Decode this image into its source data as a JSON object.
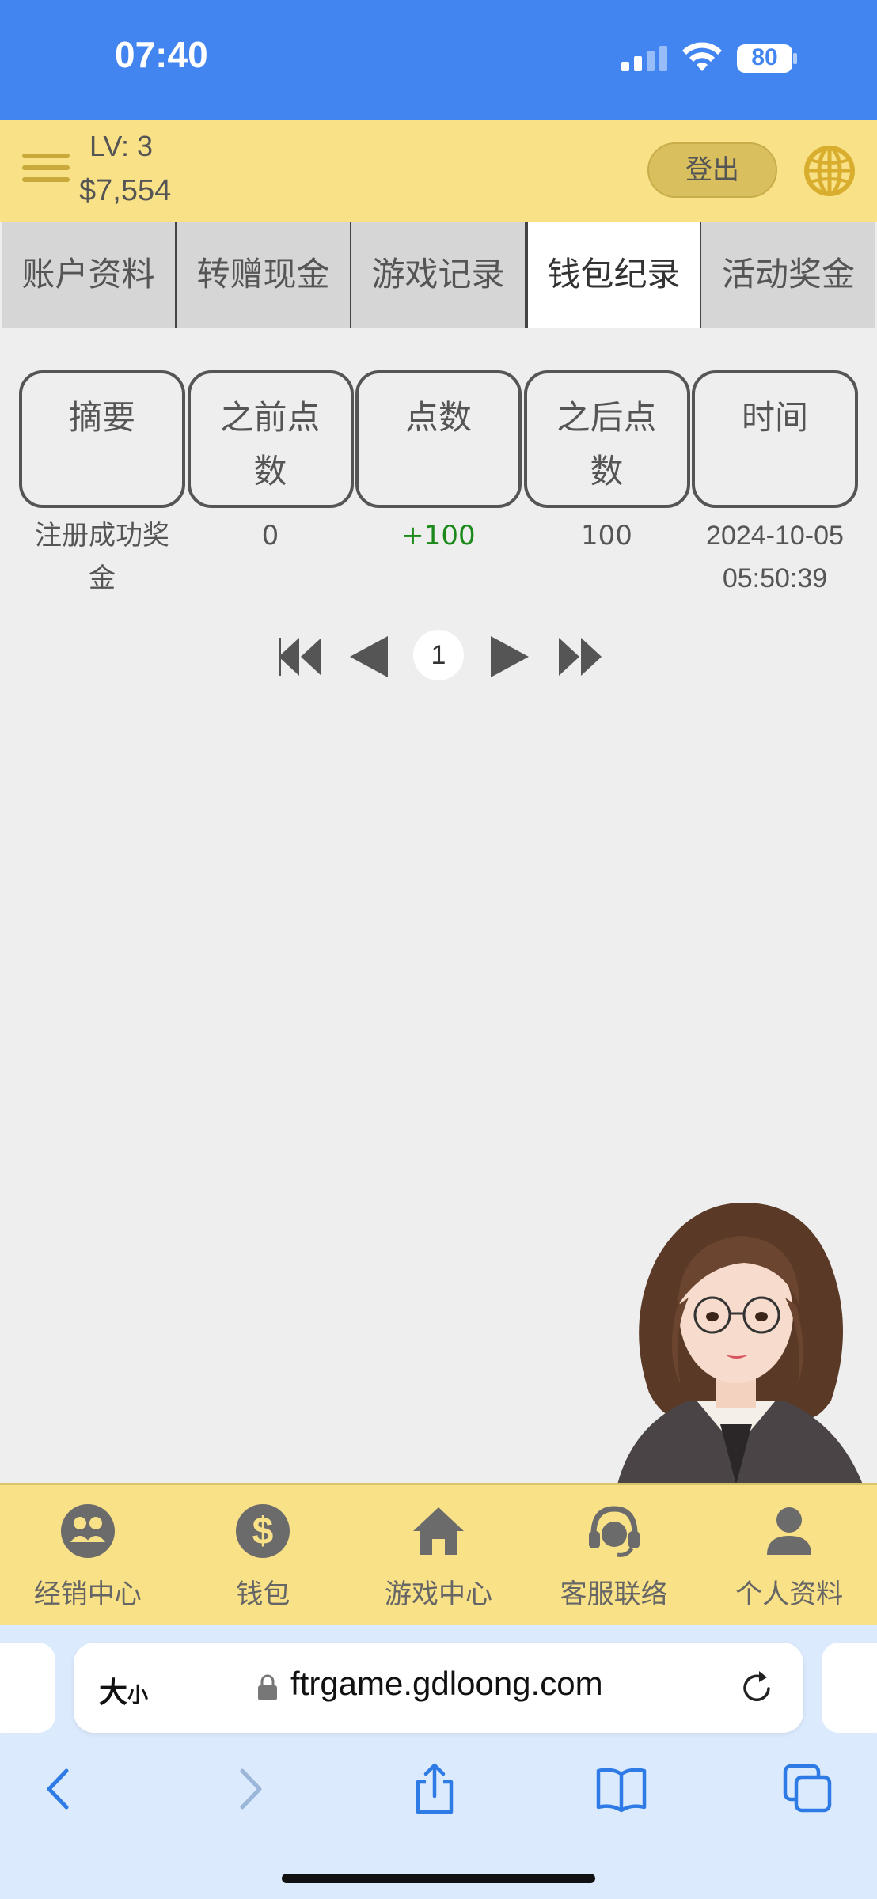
{
  "status_bar": {
    "time": "07:40",
    "battery": "80",
    "signal_icon": "cellular-signal-icon",
    "wifi_icon": "wifi-icon"
  },
  "header": {
    "level": "LV: 3",
    "balance": "$7,554",
    "logout_label": "登出",
    "menu_icon": "hamburger-menu-icon",
    "language_icon": "globe-icon",
    "bg_color": "#f9e187"
  },
  "tabs": [
    {
      "label": "账户资料",
      "active": false
    },
    {
      "label": "转赠现金",
      "active": false
    },
    {
      "label": "游戏记录",
      "active": false
    },
    {
      "label": "钱包纪录",
      "active": true
    },
    {
      "label": "活动奖金",
      "active": false
    }
  ],
  "table": {
    "headers": [
      "摘要",
      "之前点数",
      "点数",
      "之后点数",
      "时间"
    ],
    "rows": [
      {
        "summary": "注册成功奖金",
        "before": "0",
        "points": "+100",
        "after": "100",
        "date": "2024-10-05",
        "time": "05:50:39"
      }
    ]
  },
  "pagination": {
    "current_page": "1",
    "icons": [
      "first-page-icon",
      "prev-page-icon",
      "next-page-icon",
      "last-page-icon"
    ]
  },
  "bottom_nav": [
    {
      "label": "经销中心",
      "icon": "agent-center-icon"
    },
    {
      "label": "钱包",
      "icon": "dollar-wallet-icon"
    },
    {
      "label": "游戏中心",
      "icon": "home-icon"
    },
    {
      "label": "客服联络",
      "icon": "headset-support-icon"
    },
    {
      "label": "个人资料",
      "icon": "user-profile-icon"
    }
  ],
  "browser": {
    "text_size_label": "大",
    "text_size_small": "小",
    "url": "ftrgame.gdloong.com",
    "accent_color": "#2f7be6"
  }
}
